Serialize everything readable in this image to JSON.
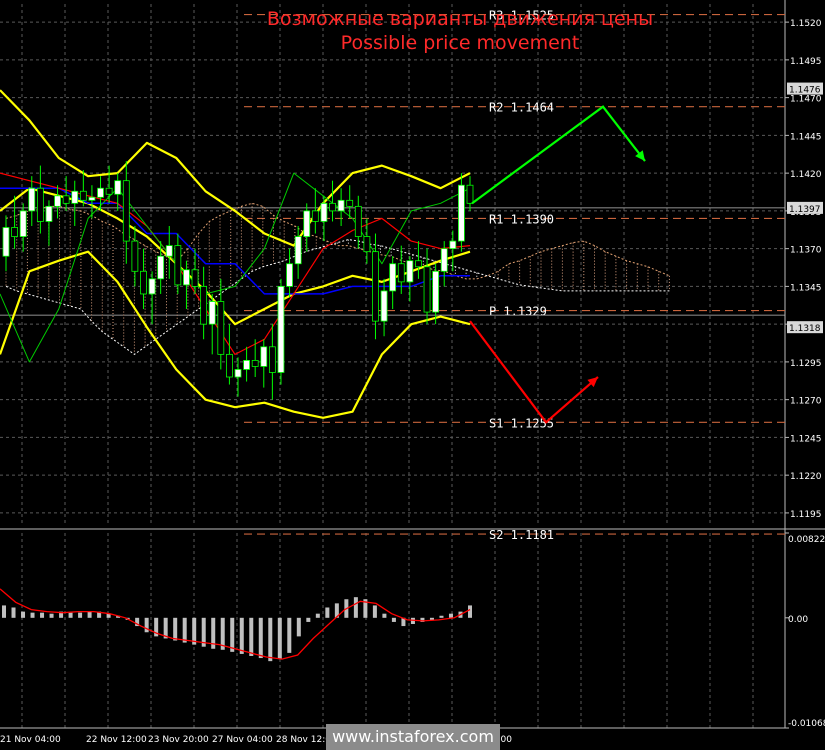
{
  "header": {
    "title_ru": "Возможные варианты движения цены",
    "title_en": "Possible price movement"
  },
  "watermark": "www.instaforex.com",
  "colors": {
    "background": "#000000",
    "grid": "#5a5a5a",
    "bollinger": "#ffff00",
    "kijun": "#0000ff",
    "tenkan": "#ff0000",
    "chikou": "#00cc00",
    "bull_candle": "#ffffff",
    "bear_candle": "#ffffff",
    "level_line": "#c8643c",
    "arrow_up": "#00ff00",
    "arrow_down": "#ff0000",
    "macd_hist": "#c0c0c0",
    "macd_signal": "#ff0000"
  },
  "chart_data": [
    {
      "type": "candlestick",
      "title": "",
      "x_tick_labels": [
        "21 Nov 04:00",
        "22 Nov 12:00",
        "23 Nov 20:00",
        "27 Nov 04:00",
        "28 Nov 12:00",
        "12:00"
      ],
      "ylim": [
        1.1187,
        1.1532
      ],
      "y_ticks": [
        1.1195,
        1.122,
        1.1245,
        1.127,
        1.1295,
        1.132,
        1.1345,
        1.137,
        1.1395,
        1.142,
        1.1445,
        1.147,
        1.1495,
        1.152
      ],
      "price_tags": [
        {
          "label": "1.1476",
          "value": 1.1476
        },
        {
          "label": "1.1397",
          "value": 1.1397
        },
        {
          "label": "1.1318",
          "value": 1.1318
        }
      ],
      "pivot_levels": [
        {
          "label": "R3  1.1525",
          "value": 1.1525
        },
        {
          "label": "R2  1.1464",
          "value": 1.1464
        },
        {
          "label": "R1  1.1390",
          "value": 1.139
        },
        {
          "label": "P  1.1329",
          "value": 1.1329
        },
        {
          "label": "S1  1.1255",
          "value": 1.1255
        },
        {
          "label": "S2  1.1181",
          "value": 1.1181
        }
      ],
      "candles": [
        [
          1.1365,
          1.1392,
          1.1355,
          1.1384
        ],
        [
          1.1384,
          1.1405,
          1.137,
          1.1378
        ],
        [
          1.1378,
          1.14,
          1.1368,
          1.1395
        ],
        [
          1.1395,
          1.1418,
          1.1385,
          1.141
        ],
        [
          1.141,
          1.1425,
          1.138,
          1.1388
        ],
        [
          1.1388,
          1.1402,
          1.1372,
          1.1398
        ],
        [
          1.1398,
          1.1412,
          1.139,
          1.1405
        ],
        [
          1.1405,
          1.1418,
          1.1395,
          1.14
        ],
        [
          1.14,
          1.1415,
          1.1385,
          1.1408
        ],
        [
          1.1408,
          1.1422,
          1.1398,
          1.1402
        ],
        [
          1.1402,
          1.1412,
          1.139,
          1.1404
        ],
        [
          1.1404,
          1.1418,
          1.1395,
          1.141
        ],
        [
          1.141,
          1.1425,
          1.14,
          1.1406
        ],
        [
          1.1406,
          1.142,
          1.1395,
          1.1415
        ],
        [
          1.1415,
          1.1428,
          1.136,
          1.1375
        ],
        [
          1.1375,
          1.1385,
          1.1345,
          1.1355
        ],
        [
          1.1355,
          1.137,
          1.133,
          1.134
        ],
        [
          1.134,
          1.1355,
          1.132,
          1.135
        ],
        [
          1.135,
          1.1375,
          1.134,
          1.1365
        ],
        [
          1.1365,
          1.1385,
          1.135,
          1.1372
        ],
        [
          1.1372,
          1.138,
          1.134,
          1.1346
        ],
        [
          1.1346,
          1.1362,
          1.133,
          1.1356
        ],
        [
          1.1356,
          1.137,
          1.134,
          1.1345
        ],
        [
          1.1345,
          1.1358,
          1.131,
          1.132
        ],
        [
          1.132,
          1.134,
          1.13,
          1.1335
        ],
        [
          1.1335,
          1.135,
          1.129,
          1.13
        ],
        [
          1.13,
          1.132,
          1.128,
          1.1285
        ],
        [
          1.1285,
          1.1298,
          1.1272,
          1.129
        ],
        [
          1.129,
          1.1305,
          1.1282,
          1.1296
        ],
        [
          1.1296,
          1.131,
          1.1285,
          1.1292
        ],
        [
          1.1292,
          1.131,
          1.1278,
          1.1305
        ],
        [
          1.1305,
          1.132,
          1.127,
          1.1288
        ],
        [
          1.1288,
          1.135,
          1.128,
          1.1345
        ],
        [
          1.1345,
          1.137,
          1.1338,
          1.136
        ],
        [
          1.136,
          1.1385,
          1.135,
          1.1378
        ],
        [
          1.1378,
          1.14,
          1.1368,
          1.1395
        ],
        [
          1.1395,
          1.141,
          1.138,
          1.1388
        ],
        [
          1.1388,
          1.1405,
          1.1375,
          1.14
        ],
        [
          1.14,
          1.1415,
          1.1388,
          1.1395
        ],
        [
          1.1395,
          1.141,
          1.1385,
          1.1402
        ],
        [
          1.1402,
          1.1412,
          1.139,
          1.1398
        ],
        [
          1.1398,
          1.1405,
          1.137,
          1.1378
        ],
        [
          1.1378,
          1.139,
          1.136,
          1.1368
        ],
        [
          1.1368,
          1.138,
          1.131,
          1.1322
        ],
        [
          1.1322,
          1.135,
          1.1312,
          1.1342
        ],
        [
          1.1342,
          1.1365,
          1.133,
          1.136
        ],
        [
          1.136,
          1.1372,
          1.134,
          1.1348
        ],
        [
          1.1348,
          1.1365,
          1.1335,
          1.1362
        ],
        [
          1.1362,
          1.1375,
          1.135,
          1.1358
        ],
        [
          1.1358,
          1.137,
          1.132,
          1.1328
        ],
        [
          1.1328,
          1.136,
          1.132,
          1.1355
        ],
        [
          1.1355,
          1.1375,
          1.1345,
          1.137
        ],
        [
          1.137,
          1.1382,
          1.1355,
          1.1375
        ],
        [
          1.1375,
          1.142,
          1.1368,
          1.1412
        ],
        [
          1.1412,
          1.1418,
          1.1395,
          1.14
        ]
      ],
      "indicators": [
        {
          "name": "upper_band",
          "values": [
            1.1475,
            1.1455,
            1.143,
            1.1418,
            1.142,
            1.144,
            1.143,
            1.1408,
            1.1395,
            1.138,
            1.1372,
            1.14,
            1.142,
            1.1425,
            1.1418,
            1.141,
            1.142
          ]
        },
        {
          "name": "middle_band",
          "values": [
            1.1395,
            1.141,
            1.1405,
            1.14,
            1.139,
            1.1378,
            1.136,
            1.1342,
            1.132,
            1.133,
            1.134,
            1.1345,
            1.1352,
            1.1348,
            1.1355,
            1.1362,
            1.1368
          ]
        },
        {
          "name": "lower_band",
          "values": [
            1.13,
            1.1355,
            1.1362,
            1.1368,
            1.1348,
            1.1318,
            1.129,
            1.127,
            1.1265,
            1.1268,
            1.1262,
            1.1258,
            1.1262,
            1.13,
            1.132,
            1.1325,
            1.132
          ]
        },
        {
          "name": "kijun",
          "values": [
            1.141,
            1.141,
            1.141,
            1.14,
            1.14,
            1.138,
            1.138,
            1.136,
            1.136,
            1.134,
            1.134,
            1.134,
            1.1345,
            1.1345,
            1.1345,
            1.1352,
            1.1352
          ]
        },
        {
          "name": "tenkan",
          "values": [
            1.142,
            1.1415,
            1.141,
            1.1405,
            1.14,
            1.1385,
            1.136,
            1.133,
            1.13,
            1.131,
            1.134,
            1.137,
            1.1382,
            1.139,
            1.1375,
            1.137,
            1.1372
          ]
        },
        {
          "name": "chikou",
          "values": [
            1.134,
            1.1295,
            1.133,
            1.139,
            1.141,
            1.1385,
            1.136,
            1.134,
            1.1345,
            1.137,
            1.142,
            1.1405,
            1.139,
            1.136,
            1.1395,
            1.14,
            1.141
          ]
        }
      ]
    },
    {
      "type": "bar",
      "title": "",
      "ylim": [
        -0.01068,
        0.00822
      ],
      "y_ticks": [
        0.00822,
        0.0,
        -0.01068
      ],
      "y_tick_labels": [
        "0.00822",
        "0.00",
        "-0.01068"
      ],
      "histogram": [
        0.0012,
        0.001,
        0.0006,
        0.0005,
        0.0005,
        0.0004,
        0.0006,
        0.0005,
        0.0005,
        0.0006,
        0.0006,
        0.0004,
        0.0002,
        -0.0002,
        -0.0008,
        -0.0014,
        -0.0018,
        -0.002,
        -0.0022,
        -0.0024,
        -0.0026,
        -0.0028,
        -0.003,
        -0.0031,
        -0.0033,
        -0.0035,
        -0.0037,
        -0.0039,
        -0.0042,
        -0.004,
        -0.0034,
        -0.0018,
        -0.0004,
        0.0004,
        0.001,
        0.0014,
        0.0018,
        0.002,
        0.0018,
        0.0012,
        0.0004,
        -0.0004,
        -0.0008,
        -0.0006,
        -0.0004,
        -0.0002,
        0.0002,
        0.0004,
        0.0006,
        0.0012
      ],
      "signal": [
        0.0028,
        0.0015,
        0.0008,
        0.0006,
        0.0005,
        0.0006,
        0.0006,
        0.0004,
        0.0,
        -0.0008,
        -0.0015,
        -0.002,
        -0.0022,
        -0.0024,
        -0.0026,
        -0.003,
        -0.0034,
        -0.0038,
        -0.004,
        -0.0036,
        -0.002,
        -0.0006,
        0.0008,
        0.0016,
        0.0014,
        0.0004,
        -0.0002,
        -0.0003,
        -0.0002,
        0.0,
        0.0008
      ]
    }
  ]
}
